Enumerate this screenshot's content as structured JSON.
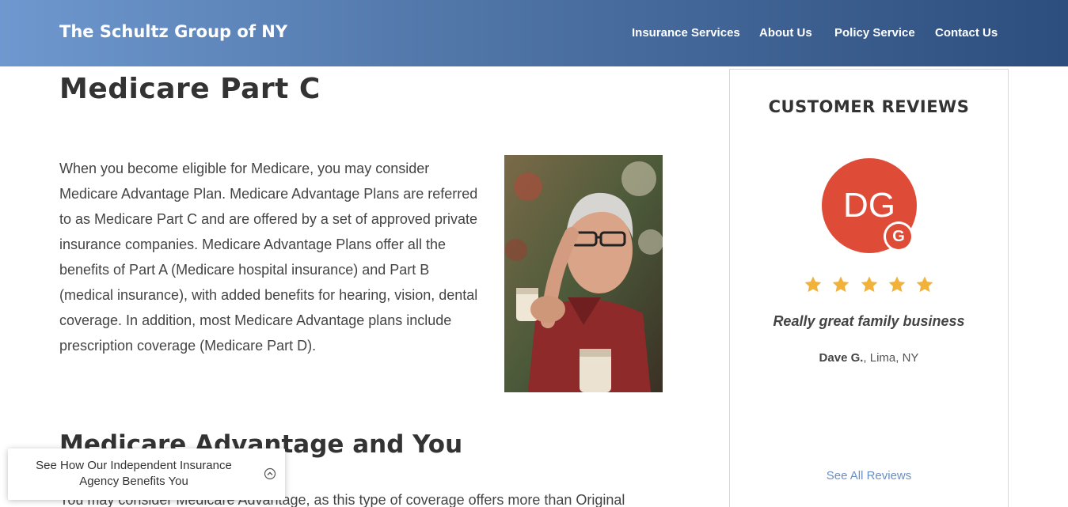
{
  "header": {
    "brand": "The Schultz Group of NY",
    "nav": [
      "Insurance Services",
      "About Us",
      "Policy Service",
      "Contact Us"
    ]
  },
  "main": {
    "title": "Medicare Part C",
    "intro": "When you become eligible for Medicare, you may consider Medicare Advantage Plan. Medicare Advantage Plans are referred to as Medicare Part C and are offered by a set of approved private insurance companies. Medicare Advantage Plans offer all the benefits of Part A (Medicare hospital insurance) and Part B (medical insurance), with added benefits for hearing, vision, dental coverage. In addition, most Medicare Advantage plans include prescription coverage (Medicare Part D).",
    "section_title": "Medicare Advantage and You",
    "section_text": "You may consider Medicare Advantage, as this type of coverage offers more than Original"
  },
  "reviews": {
    "title": "CUSTOMER REVIEWS",
    "avatar_initials": "DG",
    "badge_letter": "G",
    "rating": 5,
    "quote": "Really great family business",
    "reviewer_name": "Dave G.",
    "reviewer_location": ", Lima, NY",
    "see_all": "See All Reviews"
  },
  "popup": {
    "line1": "See How Our Independent Insurance",
    "line2": "Agency Benefits You"
  },
  "colors": {
    "header_start": "#6e98cf",
    "header_end": "#2c4e7e",
    "avatar": "#de4c38",
    "star": "#f0b23a",
    "link": "#6a8fc3"
  }
}
